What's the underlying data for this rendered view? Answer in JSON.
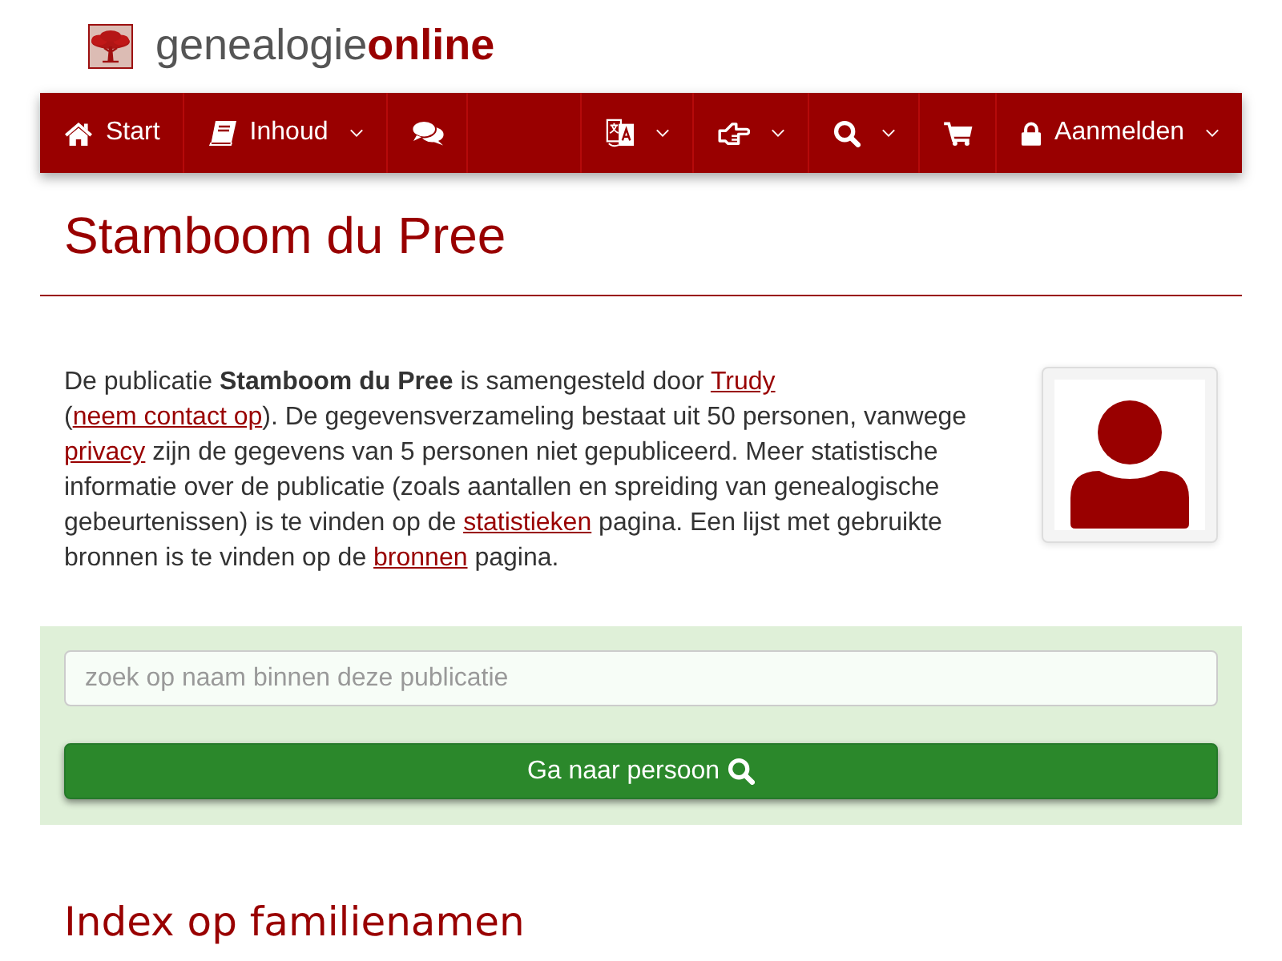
{
  "logo": {
    "text": "genealogie**online**"
  },
  "navbar": {
    "left": [
      {
        "label": "Start",
        "dropdown": false
      },
      {
        "label": "Inhoud",
        "dropdown": true
      },
      {
        "dropdown": false
      }
    ],
    "right": [
      {
        "dropdown": true
      },
      {
        "dropdown": true
      },
      {
        "dropdown": true
      },
      {
        "dropdown": false
      },
      {
        "label": "Aanmelden",
        "dropdown": true
      }
    ]
  },
  "title": "Stamboom du Pree",
  "intro": [
    {
      "kind": "text",
      "text": "De publicatie **Stamboom du Pree** is samengesteld door "
    },
    {
      "kind": "link",
      "text": "Trudy"
    },
    {
      "kind": "text",
      "text": " ("
    },
    {
      "kind": "link",
      "text": "neem contact op"
    },
    {
      "kind": "text",
      "text": "). De gegevensverzameling bestaat uit 50 personen, vanwege "
    },
    {
      "kind": "link",
      "text": "privacy"
    },
    {
      "kind": "text",
      "text": " zijn de gegevens van 5 personen niet gepubliceerd. Meer statistische informatie over de publicatie (zoals aantallen en spreiding van genealogische gebeurtenissen) is te vinden op de "
    },
    {
      "kind": "link",
      "text": "statistieken"
    },
    {
      "kind": "text",
      "text": " pagina. Een lijst met gebruikte bronnen is te vinden op de "
    },
    {
      "kind": "link",
      "text": "bronnen"
    },
    {
      "kind": "text",
      "text": " pagina."
    }
  ],
  "search": {
    "placeholder": "zoek op naam binnen deze publicatie",
    "button": "Ga naar persoon"
  },
  "section_heading": "Index op familienamen"
}
